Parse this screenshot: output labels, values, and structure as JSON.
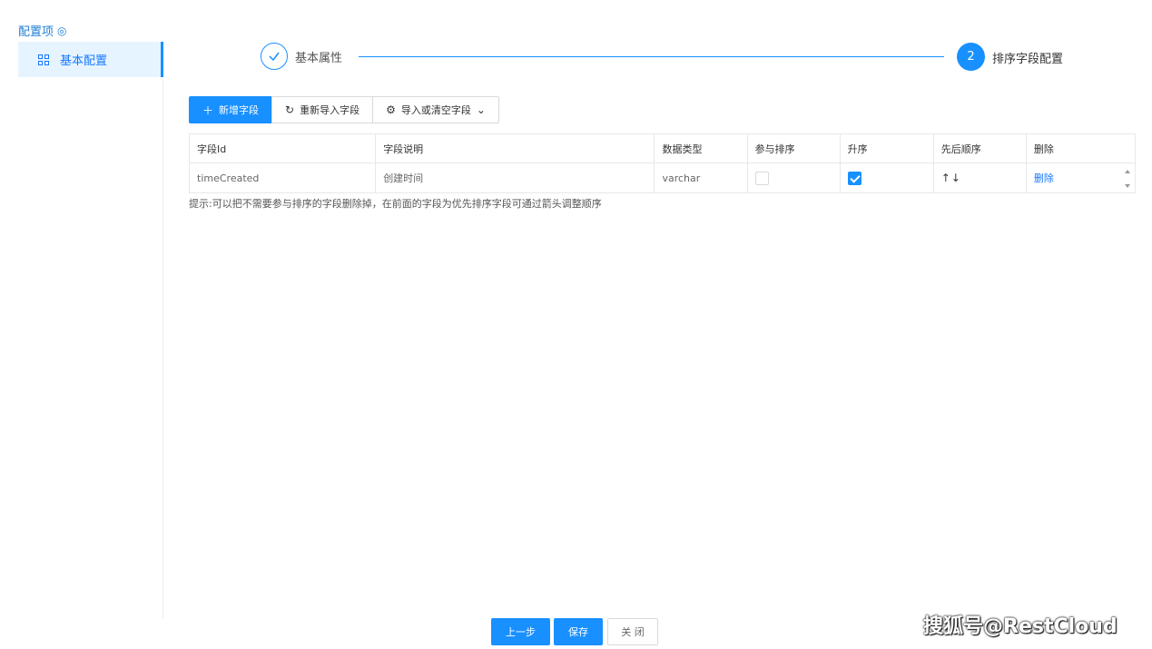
{
  "sidebar": {
    "title": "配置项",
    "items": [
      {
        "label": "基本配置"
      }
    ]
  },
  "steps": [
    {
      "label": "基本属性",
      "status": "done"
    },
    {
      "number": "2",
      "label": "排序字段配置",
      "status": "active"
    }
  ],
  "toolbar": {
    "add_label": "新增字段",
    "reimport_label": "重新导入字段",
    "import_clear_label": "导入或清空字段"
  },
  "table": {
    "headers": [
      "字段Id",
      "字段说明",
      "数据类型",
      "参与排序",
      "升序",
      "先后顺序",
      "删除"
    ],
    "rows": [
      {
        "field_id": "timeCreated",
        "desc": "创建时间",
        "type": "varchar",
        "sort": false,
        "asc": true,
        "order": "↑↓",
        "delete": "删除"
      }
    ]
  },
  "hint": "提示:可以把不需要参与排序的字段删除掉，在前面的字段为优先排序字段可通过箭头调整顺序",
  "footer": {
    "prev_label": "上一步",
    "save_label": "保存",
    "close_label": "关 闭"
  },
  "watermark": "搜狐号@RestCloud",
  "colors": {
    "primary": "#1890ff",
    "border": "#d9d9d9"
  }
}
